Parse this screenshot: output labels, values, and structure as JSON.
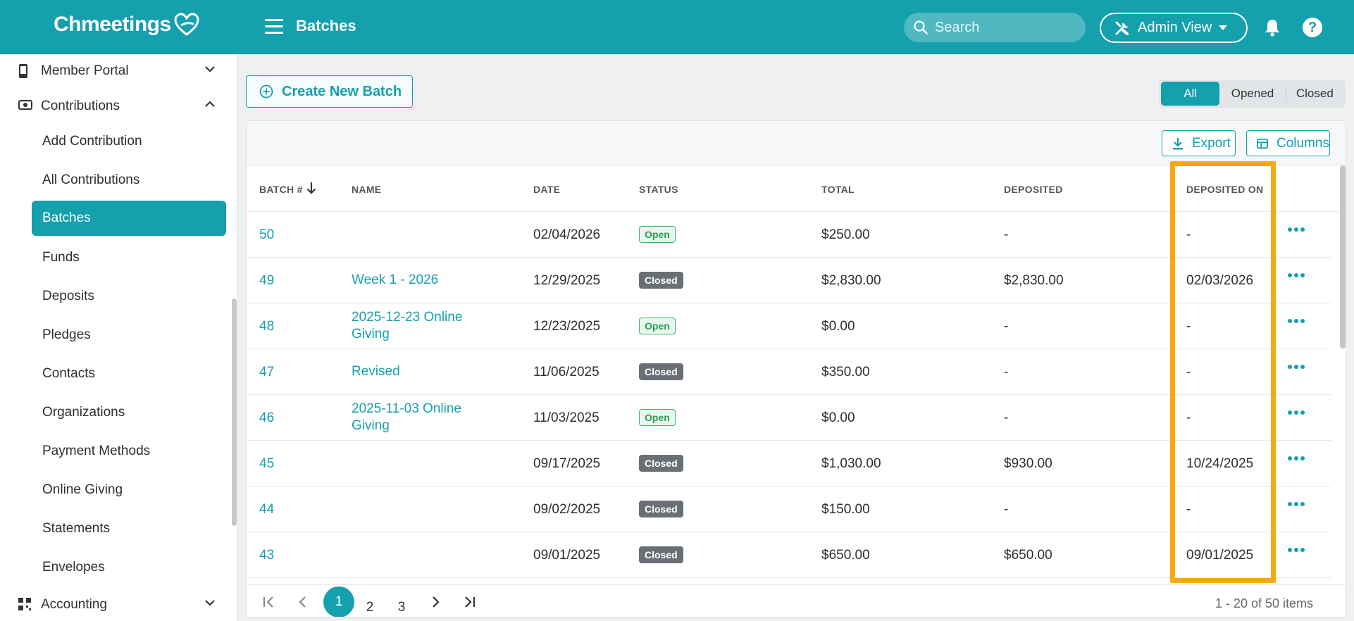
{
  "app": {
    "logo_text": "Chmeetings",
    "page_title": "Batches"
  },
  "header": {
    "search": {
      "placeholder": "Search",
      "icon": "search-icon"
    },
    "view_selector": {
      "label": "Admin View",
      "icon": "tools-icon"
    },
    "notifications_icon": "bell-icon",
    "help_label": "?"
  },
  "sidebar": {
    "items": [
      {
        "label": "Member Portal",
        "icon": "mobile-icon",
        "expanded": false
      },
      {
        "label": "Contributions",
        "icon": "money-icon",
        "expanded": true
      },
      {
        "label": "Accounting",
        "icon": "qr-icon",
        "expanded": false
      }
    ],
    "sub_items": [
      {
        "label": "Add Contribution"
      },
      {
        "label": "All Contributions"
      },
      {
        "label": "Batches",
        "active": true
      },
      {
        "label": "Funds"
      },
      {
        "label": "Deposits"
      },
      {
        "label": "Pledges"
      },
      {
        "label": "Contacts"
      },
      {
        "label": "Organizations"
      },
      {
        "label": "Payment Methods"
      },
      {
        "label": "Online Giving"
      },
      {
        "label": "Statements"
      },
      {
        "label": "Envelopes"
      }
    ]
  },
  "main": {
    "create_button": "Create New Batch",
    "filter": {
      "options": [
        "All",
        "Opened",
        "Closed"
      ],
      "selected": "All"
    },
    "toolbar": {
      "export_label": "Export",
      "columns_label": "Columns"
    },
    "columns": [
      "BATCH #",
      "NAME",
      "DATE",
      "STATUS",
      "TOTAL",
      "DEPOSITED",
      "DEPOSITED ON"
    ],
    "sort": {
      "column": "BATCH #",
      "direction": "desc"
    },
    "rows": [
      {
        "batch": "50",
        "name": "",
        "date": "02/04/2026",
        "status": "Open",
        "total": "$250.00",
        "deposited": "-",
        "deposited_on": "-"
      },
      {
        "batch": "49",
        "name": "Week 1 - 2026",
        "date": "12/29/2025",
        "status": "Closed",
        "total": "$2,830.00",
        "deposited": "$2,830.00",
        "deposited_on": "02/03/2026"
      },
      {
        "batch": "48",
        "name": "2025-12-23 Online Giving",
        "date": "12/23/2025",
        "status": "Open",
        "total": "$0.00",
        "deposited": "-",
        "deposited_on": "-"
      },
      {
        "batch": "47",
        "name": "Revised",
        "date": "11/06/2025",
        "status": "Closed",
        "total": "$350.00",
        "deposited": "-",
        "deposited_on": "-"
      },
      {
        "batch": "46",
        "name": "2025-11-03 Online Giving",
        "date": "11/03/2025",
        "status": "Open",
        "total": "$0.00",
        "deposited": "-",
        "deposited_on": "-"
      },
      {
        "batch": "45",
        "name": "",
        "date": "09/17/2025",
        "status": "Closed",
        "total": "$1,030.00",
        "deposited": "$930.00",
        "deposited_on": "10/24/2025"
      },
      {
        "batch": "44",
        "name": "",
        "date": "09/02/2025",
        "status": "Closed",
        "total": "$150.00",
        "deposited": "-",
        "deposited_on": "-"
      },
      {
        "batch": "43",
        "name": "",
        "date": "09/01/2025",
        "status": "Closed",
        "total": "$650.00",
        "deposited": "$650.00",
        "deposited_on": "09/01/2025"
      }
    ],
    "pagination": {
      "pages": [
        "1",
        "2",
        "3"
      ],
      "current": "1",
      "info": "1 - 20 of 50 items"
    }
  },
  "colors": {
    "primary": "#14a0ad",
    "highlight": "#f6a912",
    "open_badge": "#2a9d52",
    "closed_badge": "#6a6f75"
  }
}
